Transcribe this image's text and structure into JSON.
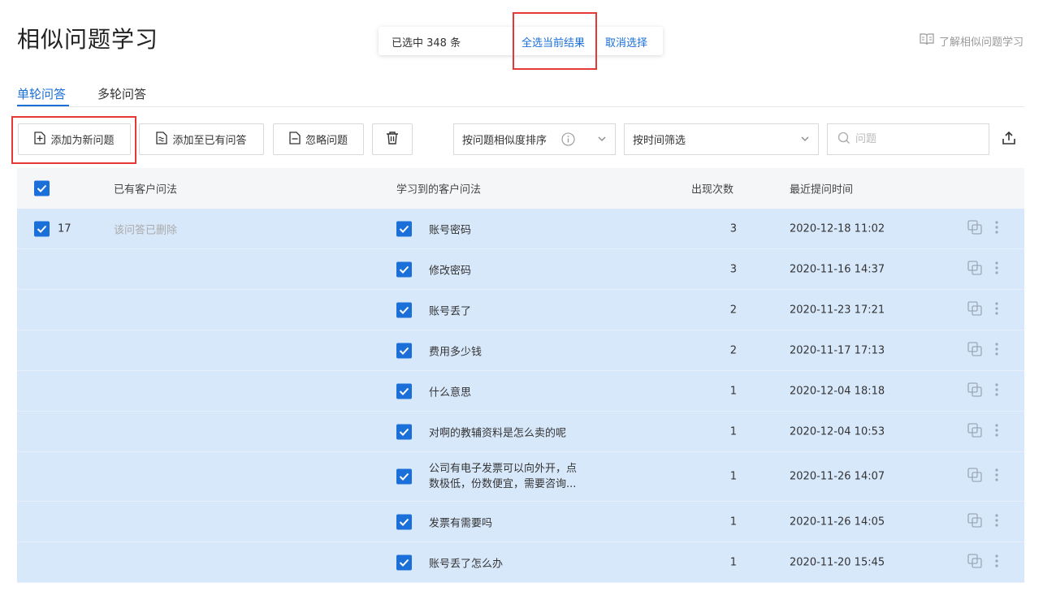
{
  "page": {
    "title": "相似问题学习"
  },
  "selection": {
    "count_text": "已选中 348 条",
    "select_all": "全选当前结果",
    "cancel": "取消选择"
  },
  "help": {
    "label": "了解相似问题学习",
    "icon": "book-icon"
  },
  "tabs": [
    {
      "label": "单轮问答",
      "active": true
    },
    {
      "label": "多轮问答",
      "active": false
    }
  ],
  "toolbar": {
    "add_new": "添加为新问题",
    "add_existing": "添加至已有问答",
    "ignore": "忽略问题",
    "sort_select": "按问题相似度排序",
    "time_filter": "按时间筛选",
    "search_placeholder": "问题"
  },
  "table": {
    "headers": {
      "existing": "已有客户问法",
      "learned": "学习到的客户问法",
      "count": "出现次数",
      "last_time": "最近提问时间"
    },
    "group": {
      "id": "17",
      "existing_text": "该问答已删除"
    },
    "rows": [
      {
        "question": "账号密码",
        "count": "3",
        "time": "2020-12-18 11:02"
      },
      {
        "question": "修改密码",
        "count": "3",
        "time": "2020-11-16 14:37"
      },
      {
        "question": "账号丢了",
        "count": "2",
        "time": "2020-11-23 17:21"
      },
      {
        "question": "费用多少钱",
        "count": "2",
        "time": "2020-11-17 17:13"
      },
      {
        "question": "什么意思",
        "count": "1",
        "time": "2020-12-04 18:18"
      },
      {
        "question": "对啊的教辅资料是怎么卖的呢",
        "count": "1",
        "time": "2020-12-04 10:53"
      },
      {
        "question": "公司有电子发票可以向外开，点",
        "question_line2": "数极低，份数便宜，需要咨询...",
        "count": "1",
        "time": "2020-11-26 14:07"
      },
      {
        "question": "发票有需要吗",
        "count": "1",
        "time": "2020-11-26 14:05"
      },
      {
        "question": "账号丢了怎么办",
        "count": "1",
        "time": "2020-11-20 15:45"
      }
    ]
  },
  "colors": {
    "accent": "#1a6fd8",
    "row_selected": "#d8e8fb",
    "highlight": "#e53935"
  }
}
